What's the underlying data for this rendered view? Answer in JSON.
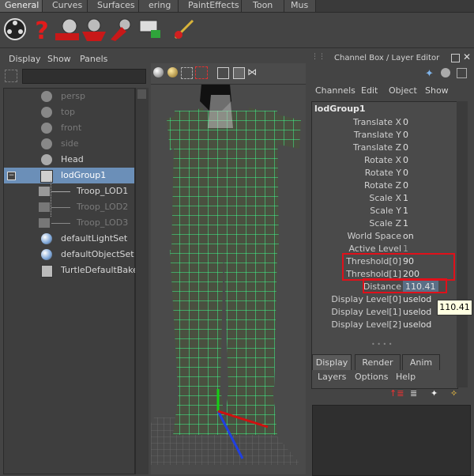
{
  "shelf_tabs": [
    {
      "label": "General",
      "active": true
    },
    {
      "label": "Curves",
      "active": false
    },
    {
      "label": "Surfaces",
      "active": false
    },
    {
      "label": "ering",
      "active": false
    },
    {
      "label": "PaintEffects",
      "active": false
    },
    {
      "label": "Toon",
      "active": false
    },
    {
      "label": "Mus",
      "active": false
    }
  ],
  "outliner": {
    "menu": [
      "Display",
      "Show",
      "Panels"
    ],
    "items": [
      {
        "label": "persp",
        "dim": true,
        "icon": "camera-icon"
      },
      {
        "label": "top",
        "dim": true,
        "icon": "camera-icon"
      },
      {
        "label": "front",
        "dim": true,
        "icon": "camera-icon"
      },
      {
        "label": "side",
        "dim": true,
        "icon": "camera-icon"
      },
      {
        "label": "Head",
        "dim": false,
        "icon": "camera-icon"
      },
      {
        "label": "lodGroup1",
        "dim": false,
        "selected": true,
        "icon": "lod-group-icon"
      },
      {
        "label": "Troop_LOD1",
        "dim": false,
        "icon": "mesh-icon"
      },
      {
        "label": "Troop_LOD2",
        "dim": true,
        "icon": "mesh-icon"
      },
      {
        "label": "Troop_LOD3",
        "dim": true,
        "icon": "mesh-icon"
      },
      {
        "label": "defaultLightSet",
        "dim": false,
        "icon": "set-icon"
      },
      {
        "label": "defaultObjectSet",
        "dim": false,
        "icon": "set-icon"
      },
      {
        "label": "TurtleDefaultBakeLa",
        "dim": false,
        "icon": "bake-layer-icon"
      }
    ]
  },
  "channel_box": {
    "title": "Channel Box / Layer Editor",
    "menu": [
      "Channels",
      "Edit",
      "Object",
      "Show"
    ],
    "node": "lodGroup1",
    "channels": [
      {
        "label": "Translate X",
        "value": "0"
      },
      {
        "label": "Translate Y",
        "value": "0"
      },
      {
        "label": "Translate Z",
        "value": "0"
      },
      {
        "label": "Rotate X",
        "value": "0"
      },
      {
        "label": "Rotate Y",
        "value": "0"
      },
      {
        "label": "Rotate Z",
        "value": "0"
      },
      {
        "label": "Scale X",
        "value": "1"
      },
      {
        "label": "Scale Y",
        "value": "1"
      },
      {
        "label": "Scale Z",
        "value": "1"
      },
      {
        "label": "World Space",
        "value": "on"
      },
      {
        "label": "Active Level",
        "value": "1"
      },
      {
        "label": "Threshold[0]",
        "value": "90"
      },
      {
        "label": "Threshold[1]",
        "value": "200"
      },
      {
        "label": "Distance",
        "value": "110.41"
      },
      {
        "label": "Display Level[0]",
        "value": "uselod"
      },
      {
        "label": "Display Level[1]",
        "value": "uselod"
      },
      {
        "label": "Display Level[2]",
        "value": "uselod"
      }
    ],
    "tooltip": "110.41"
  },
  "layer_editor": {
    "tabs": [
      {
        "label": "Display",
        "active": true
      },
      {
        "label": "Render",
        "active": false
      },
      {
        "label": "Anim",
        "active": false
      }
    ],
    "menu": [
      "Layers",
      "Options",
      "Help"
    ]
  },
  "colors": {
    "wireframe": "#3dfc8c",
    "highlight": "#e0101a",
    "selection": "#6b8fb8"
  }
}
